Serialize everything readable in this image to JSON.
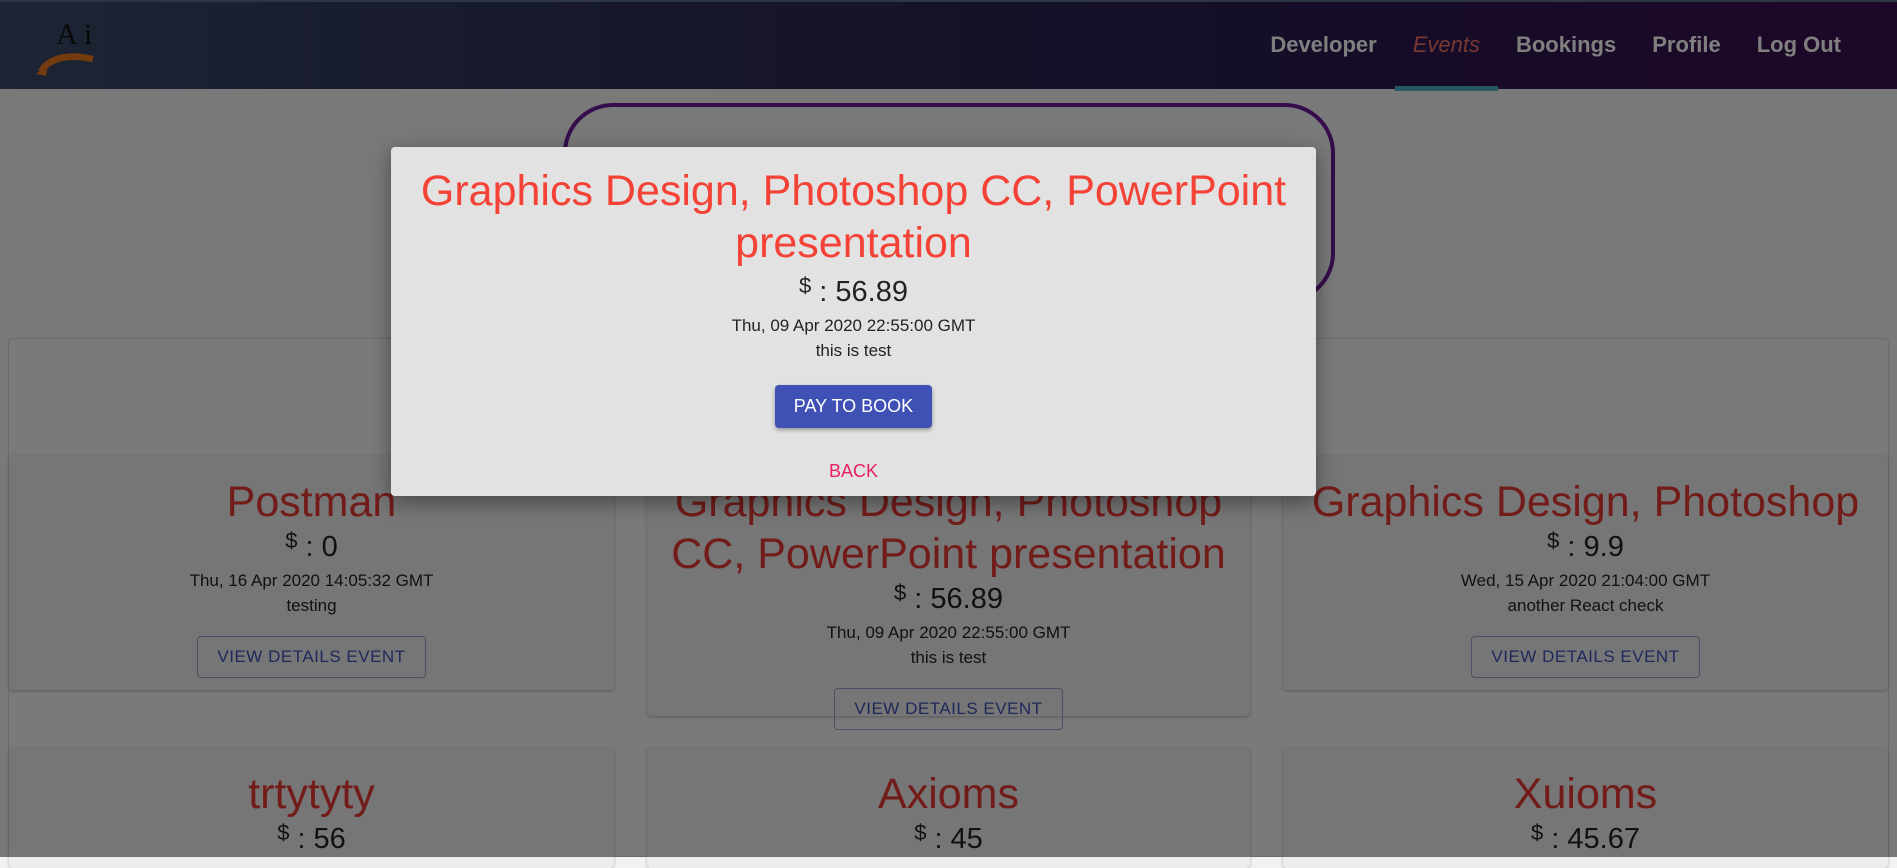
{
  "navbar": {
    "links": [
      "Developer",
      "Events",
      "Bookings",
      "Profile",
      "Log Out"
    ],
    "active_link": "Events",
    "accent_color": "#4db3c7"
  },
  "currency_symbol": "$",
  "events": [
    {
      "title": "Postman",
      "price": ": 0",
      "date": "Thu, 16 Apr 2020 14:05:32 GMT",
      "description": "testing",
      "button": "VIEW DETAILS EVENT"
    },
    {
      "title": "Graphics Design, Photoshop CC, PowerPoint presentation",
      "price": ": 56.89",
      "date": "Thu, 09 Apr 2020 22:55:00 GMT",
      "description": "this is test",
      "button": "VIEW DETAILS EVENT"
    },
    {
      "title": "Graphics Design, Photoshop",
      "price": ": 9.9",
      "date": "Wed, 15 Apr 2020 21:04:00 GMT",
      "description": "another React check",
      "button": "VIEW DETAILS EVENT"
    },
    {
      "title": "trtytyty",
      "price": ": 56"
    },
    {
      "title": "Axioms",
      "price": ": 45"
    },
    {
      "title": "Xuioms",
      "price": ": 45.67"
    }
  ],
  "modal": {
    "title": "Graphics Design, Photoshop CC, PowerPoint presentation",
    "price": ": 56.89",
    "date": "Thu, 09 Apr 2020 22:55:00 GMT",
    "description": "this is test",
    "pay_button": "PAY TO BOOK",
    "back_button": "BACK"
  },
  "colors": {
    "title_red": "#f44336",
    "primary": "#3f51b5",
    "back_pink": "#e91e63",
    "hero_border": "#6a1b9a"
  }
}
